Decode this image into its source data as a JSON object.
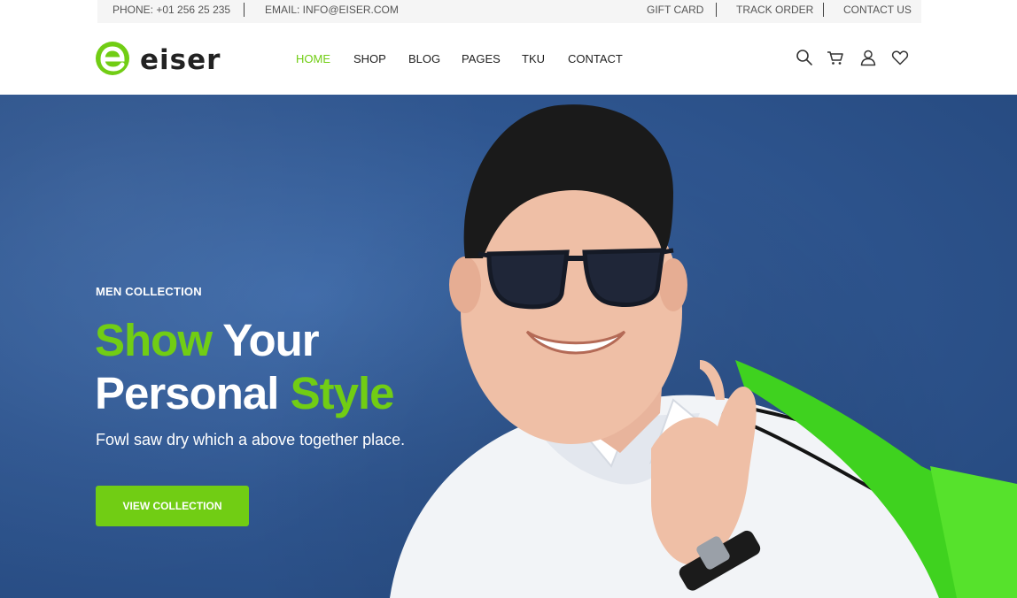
{
  "topbar": {
    "phone": "PHONE: +01 256 25 235",
    "email": "EMAIL: INFO@EISER.COM",
    "links": [
      "GIFT CARD",
      "TRACK ORDER",
      "CONTACT US"
    ]
  },
  "header": {
    "logo_text": "eiser",
    "nav": [
      "HOME",
      "SHOP",
      "BLOG",
      "PAGES",
      "TKU",
      "CONTACT"
    ],
    "active_nav": "HOME",
    "icons": [
      "search-icon",
      "cart-icon",
      "user-icon",
      "heart-icon"
    ]
  },
  "hero": {
    "kicker": "MEN COLLECTION",
    "title_line1_green": "Show",
    "title_line1_white": " Your",
    "title_line2_white": "Personal ",
    "title_line2_green": "Style",
    "subtitle": "Fowl saw dry which a above together place.",
    "button": "VIEW COLLECTION"
  },
  "colors": {
    "accent": "#71cd14",
    "hero_bg": "#2f5690",
    "text_dark": "#222222"
  }
}
